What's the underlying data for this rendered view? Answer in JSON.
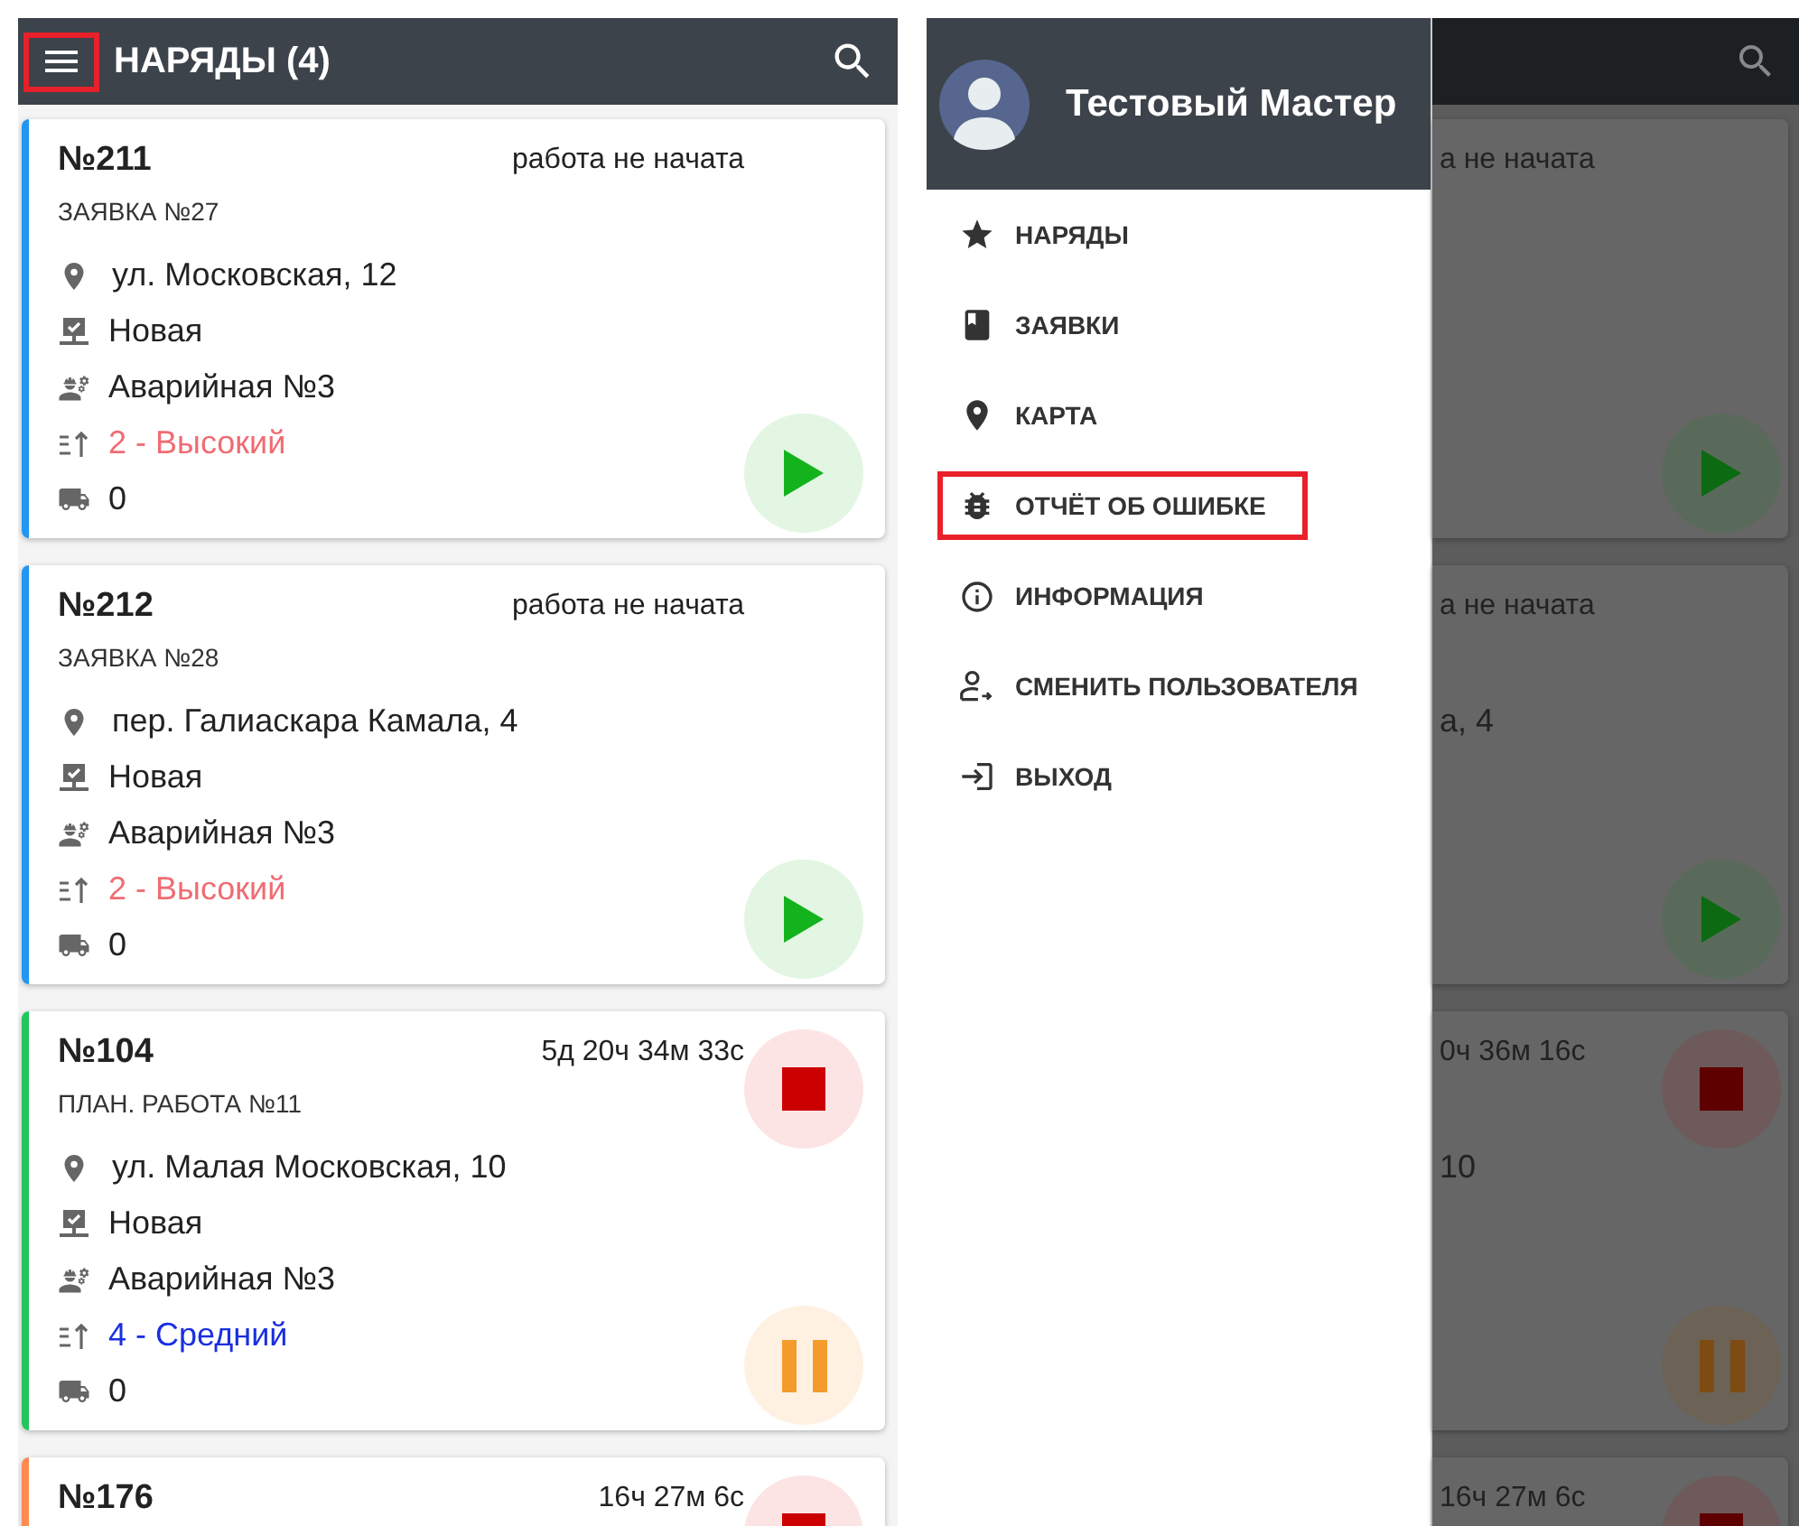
{
  "orders_screen": {
    "appbar": {
      "menu_highlighted": true,
      "title": "НАРЯДЫ (4)"
    },
    "orders": [
      {
        "number": "№211",
        "status": "работа не начата",
        "subtitle": "ЗАЯВКА №27",
        "address": "ул. Московская, 12",
        "state": "Новая",
        "brigade": "Аварийная №3",
        "priority": {
          "label": "2 - Высокий",
          "color": "#f06b73"
        },
        "vehicles": "0",
        "color": "#2196f3",
        "actions": [
          {
            "kind": "play"
          }
        ]
      },
      {
        "number": "№212",
        "status": "работа не начата",
        "subtitle": "ЗАЯВКА №28",
        "address": "пер. Галиаскара Камала, 4",
        "state": "Новая",
        "brigade": "Аварийная №3",
        "priority": {
          "label": "2 - Высокий",
          "color": "#f06b73"
        },
        "vehicles": "0",
        "color": "#2196f3",
        "actions": [
          {
            "kind": "play"
          }
        ]
      },
      {
        "number": "№104",
        "status": "5д 20ч 34м 33с",
        "subtitle": "ПЛАН. РАБОТА №11",
        "address": "ул. Малая Московская, 10",
        "state": "Новая",
        "brigade": "Аварийная №3",
        "priority": {
          "label": "4 - Средний",
          "color": "#1a2fe0"
        },
        "vehicles": "0",
        "color": "#22c55e",
        "actions": [
          {
            "kind": "stop"
          },
          {
            "kind": "pause"
          }
        ]
      },
      {
        "number": "№176",
        "status": "16ч 27м 6с",
        "color": "#ff8a50",
        "actions": [
          {
            "kind": "stop"
          }
        ]
      }
    ]
  },
  "drawer_screen": {
    "user_name": "Тестовый Мастер",
    "menu": [
      {
        "kind": "star",
        "label": "НАРЯДЫ",
        "highlighted": false
      },
      {
        "kind": "book",
        "label": "ЗАЯВКИ",
        "highlighted": false
      },
      {
        "kind": "pin",
        "label": "КАРТА",
        "highlighted": false
      },
      {
        "kind": "bug",
        "label": "ОТЧЁТ ОБ ОШИБКЕ",
        "highlighted": true
      },
      {
        "kind": "info",
        "label": "ИНФОРМАЦИЯ",
        "highlighted": false
      },
      {
        "kind": "switch_user",
        "label": "СМЕНИТЬ ПОЛЬЗОВАТЕЛЯ",
        "highlighted": false
      },
      {
        "kind": "exit",
        "label": "ВЫХОД",
        "highlighted": false
      }
    ],
    "background_orders": [
      {
        "status": "а не начата",
        "actions": [
          {
            "kind": "play"
          }
        ]
      },
      {
        "status": "а не начата",
        "address": "а, 4",
        "actions": [
          {
            "kind": "play"
          }
        ]
      },
      {
        "status": "0ч 36м 16с",
        "address": "10",
        "actions": [
          {
            "kind": "stop"
          },
          {
            "kind": "pause"
          }
        ]
      },
      {
        "status": "16ч 27м 6с",
        "actions": [
          {
            "kind": "stop"
          }
        ]
      }
    ]
  }
}
